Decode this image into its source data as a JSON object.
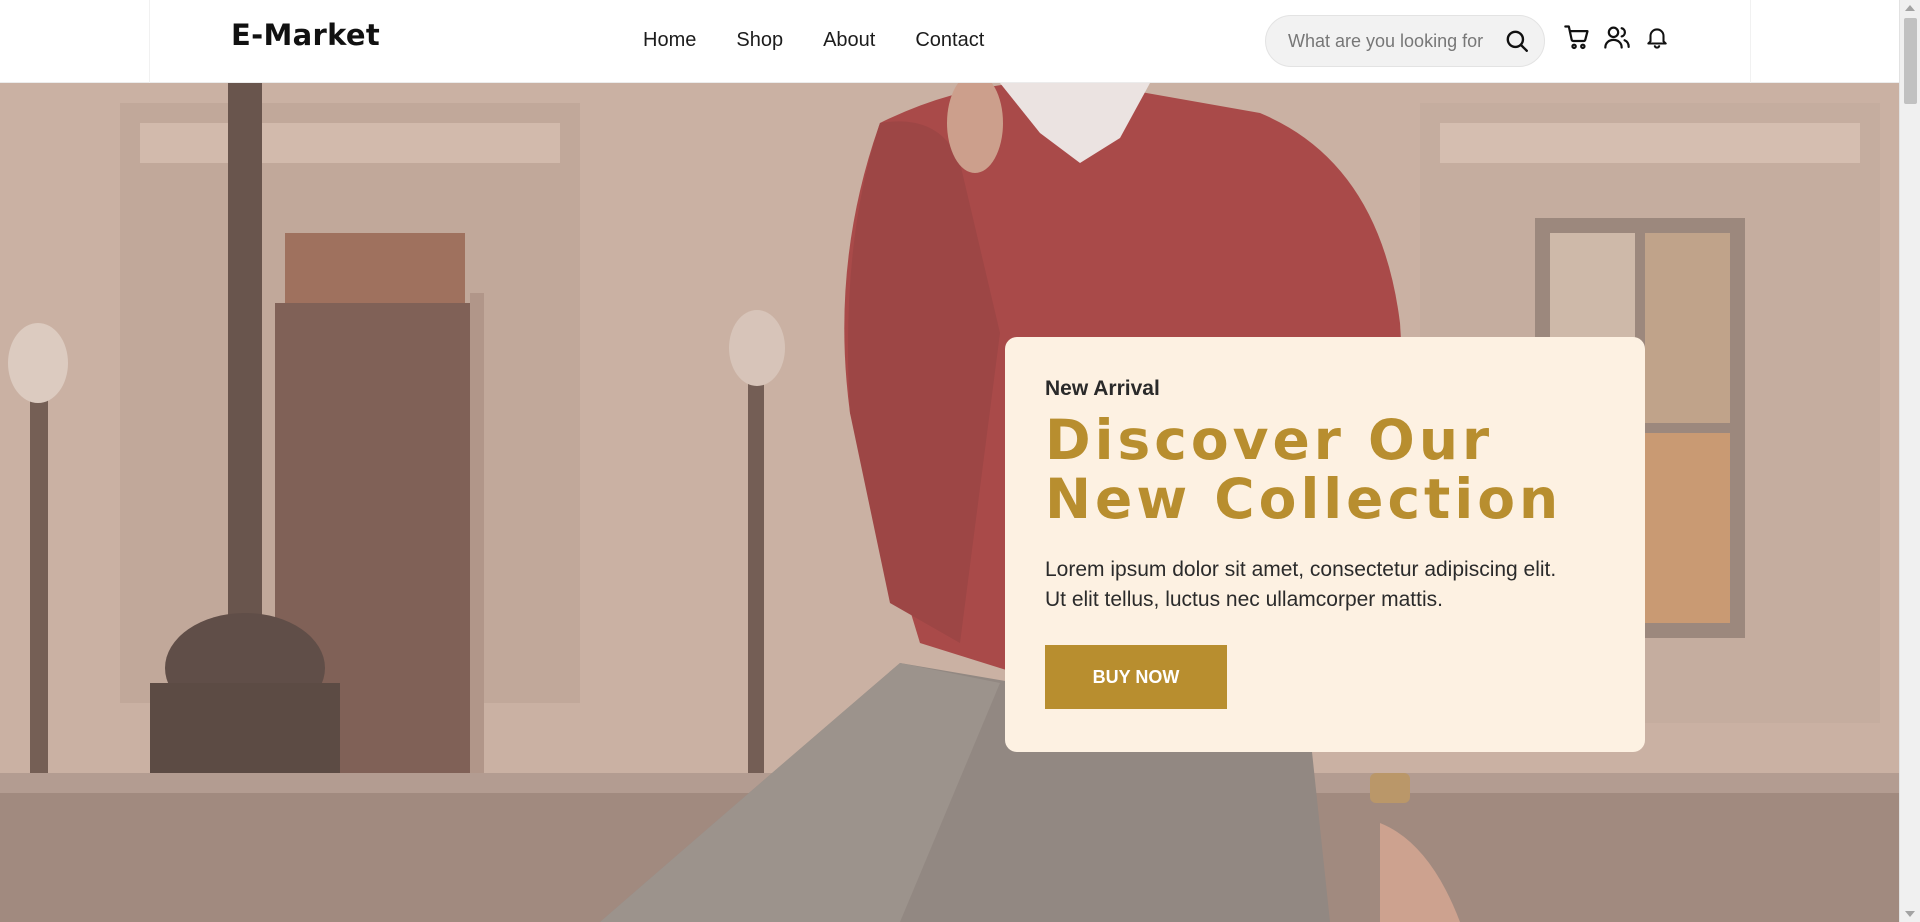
{
  "brand": {
    "logo": "E-Market"
  },
  "nav": {
    "items": [
      {
        "label": "Home"
      },
      {
        "label": "Shop"
      },
      {
        "label": "About"
      },
      {
        "label": "Contact"
      }
    ]
  },
  "search": {
    "placeholder": "What are you looking for?",
    "value": ""
  },
  "header_icons": [
    "search-icon",
    "cart-icon",
    "user-icon",
    "bell-icon"
  ],
  "hero": {
    "eyebrow": "New Arrival",
    "title_line1": "Discover Our",
    "title_line2": "New Collection",
    "desc_line1": "Lorem ipsum dolor sit amet, consectetur adipiscing elit.",
    "desc_line2": "Ut elit tellus, luctus nec ullamcorper mattis.",
    "button_label": "BUY NOW",
    "background_image": "woman-in-red-sweater-photo"
  },
  "colors": {
    "accent": "#b88e2f",
    "card_bg": "#fdf1e2",
    "text_dark": "#2b2b2b"
  }
}
